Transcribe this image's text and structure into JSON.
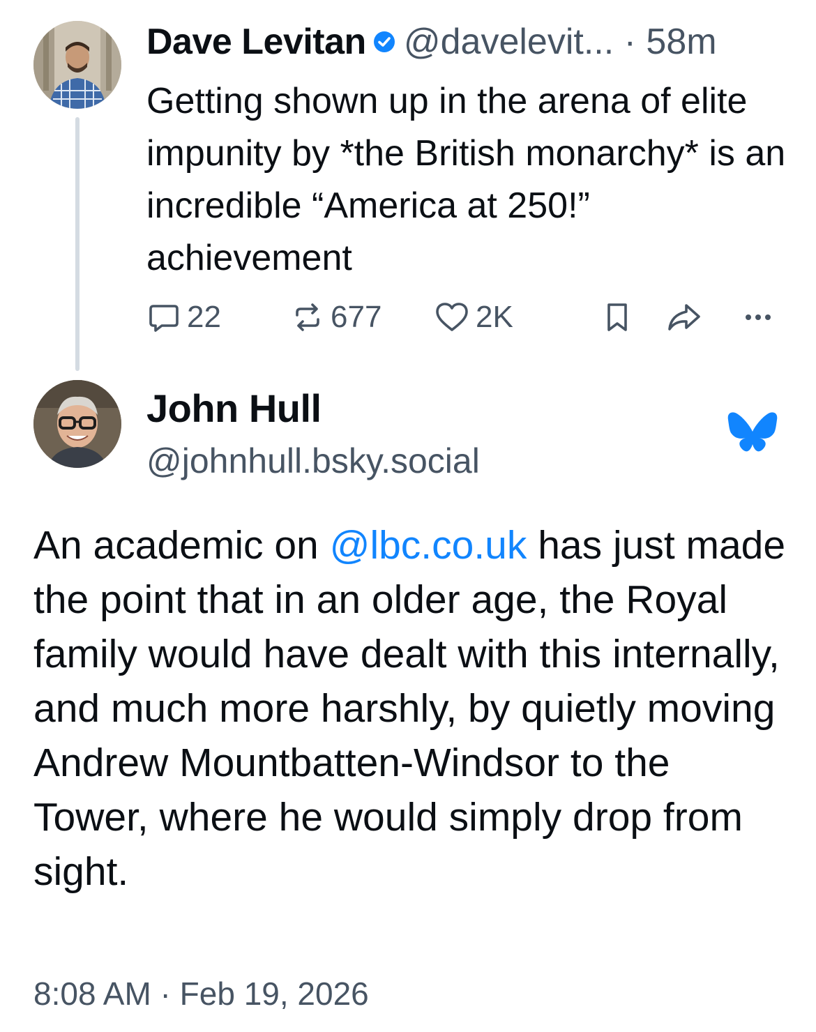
{
  "main_post": {
    "author_name": "Dave Levitan",
    "handle": "@davelevit...",
    "separator": "·",
    "time_ago": "58m",
    "text": "Getting shown up in the arena of elite impunity by *the British monarchy* is an incredible “America at 250!” achievement",
    "actions": {
      "reply_count": "22",
      "repost_count": "677",
      "like_count": "2K"
    },
    "icons": {
      "verified": "verified-badge-icon",
      "reply": "reply-bubble-icon",
      "repost": "repost-icon",
      "like": "heart-icon",
      "bookmark": "bookmark-icon",
      "share": "share-icon",
      "more": "more-options-icon"
    }
  },
  "quoted_post": {
    "author_name": "John Hull",
    "handle": "@johnhull.bsky.social",
    "logo": "bluesky-butterfly-icon",
    "body_before_link": "An academic on ",
    "link_text": "@lbc.co.uk",
    "body_after_link": " has just made the point that in an older age, the Royal family would have dealt with this internally, and much more harshly, by quietly moving Andrew Mountbatten-Windsor to the Tower, where he would simply drop from sight.",
    "timestamp": "8:08 AM · Feb 19, 2026"
  },
  "colors": {
    "text": "#0b0f14",
    "secondary": "#475463",
    "link": "#1185fe",
    "verified": "#1185fe",
    "thread_line": "#d4dbe2"
  }
}
